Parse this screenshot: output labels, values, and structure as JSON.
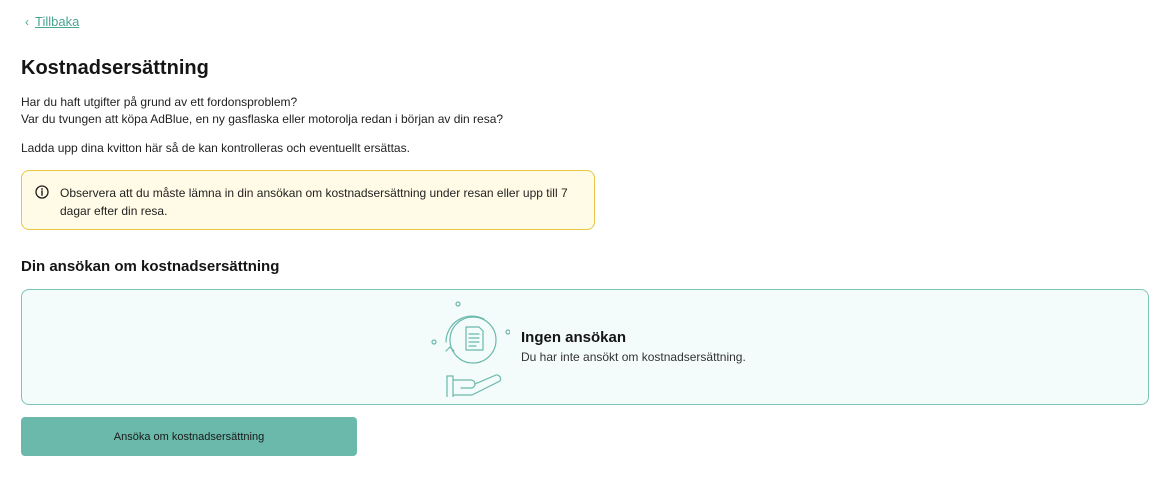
{
  "nav": {
    "back_label": "Tillbaka"
  },
  "page": {
    "title": "Kostnadsersättning",
    "intro_line1": "Har du haft utgifter på grund av ett fordonsproblem?",
    "intro_line2": "Var du tvungen att köpa AdBlue, en ny gasflaska eller motorolja redan i början av din resa?",
    "intro_line3": "Ladda upp dina kvitton här så de kan kontrolleras och eventuellt ersättas."
  },
  "notice": {
    "icon": "info-icon",
    "text": "Observera att du måste lämna in din ansökan om kostnadsersättning under resan eller upp till 7 dagar efter din resa."
  },
  "application": {
    "heading": "Din ansökan om kostnadsersättning",
    "empty_title": "Ingen ansökan",
    "empty_subtitle": "Du har inte ansökt om kostnadsersättning.",
    "illustration_icon": "receipt-hand-icon"
  },
  "actions": {
    "apply_label": "Ansöka om kostnadsersättning"
  },
  "colors": {
    "accent": "#4aa592",
    "button": "#6ab9ab",
    "panel_bg": "#f4fbfb",
    "panel_border": "#7cc4b4",
    "notice_bg": "#fffbe6",
    "notice_border": "#e8c547"
  }
}
